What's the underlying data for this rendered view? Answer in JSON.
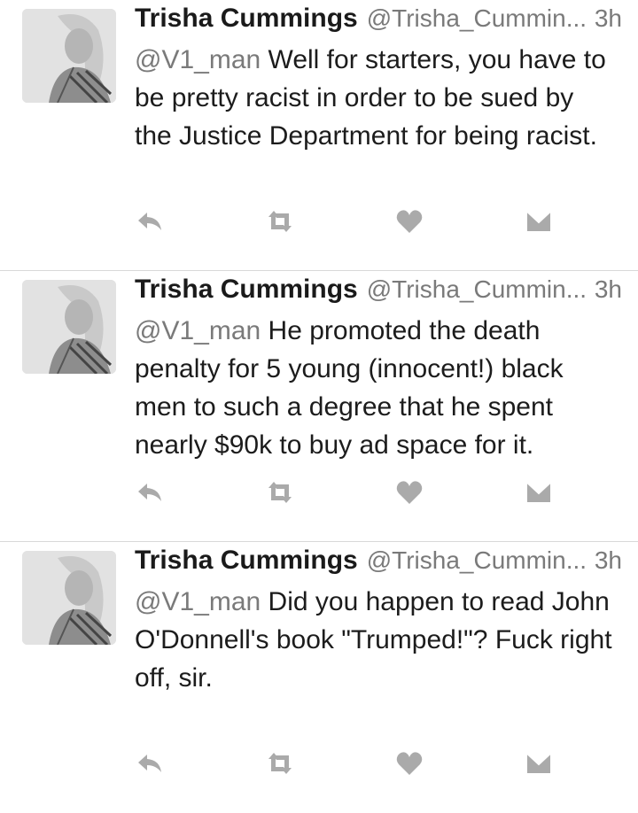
{
  "tweets": [
    {
      "name": "Trisha Cummings",
      "handle": "@Trisha_Cummin...",
      "time": "3h",
      "mention": "@V1_man",
      "text": "Well for starters, you have to be pretty racist in order to be sued by the Justice Department for being racist."
    },
    {
      "name": "Trisha Cummings",
      "handle": "@Trisha_Cummin...",
      "time": "3h",
      "mention": "@V1_man",
      "text": "He promoted the death penalty for 5 young (innocent!) black men to such a degree that he spent nearly $90k to buy ad space for it."
    },
    {
      "name": "Trisha Cummings",
      "handle": "@Trisha_Cummin...",
      "time": "3h",
      "mention": "@V1_man",
      "text": "Did you happen to read John O'Donnell's book \"Trumped!\"? Fuck right off, sir."
    }
  ],
  "icons": {
    "reply": "reply-icon",
    "retweet": "retweet-icon",
    "like": "heart-icon",
    "dm": "envelope-icon"
  },
  "colors": {
    "text": "#1c1c1c",
    "secondary": "#7a7a7a",
    "icon": "#aaaaaa",
    "divider": "#d9d9d9"
  }
}
